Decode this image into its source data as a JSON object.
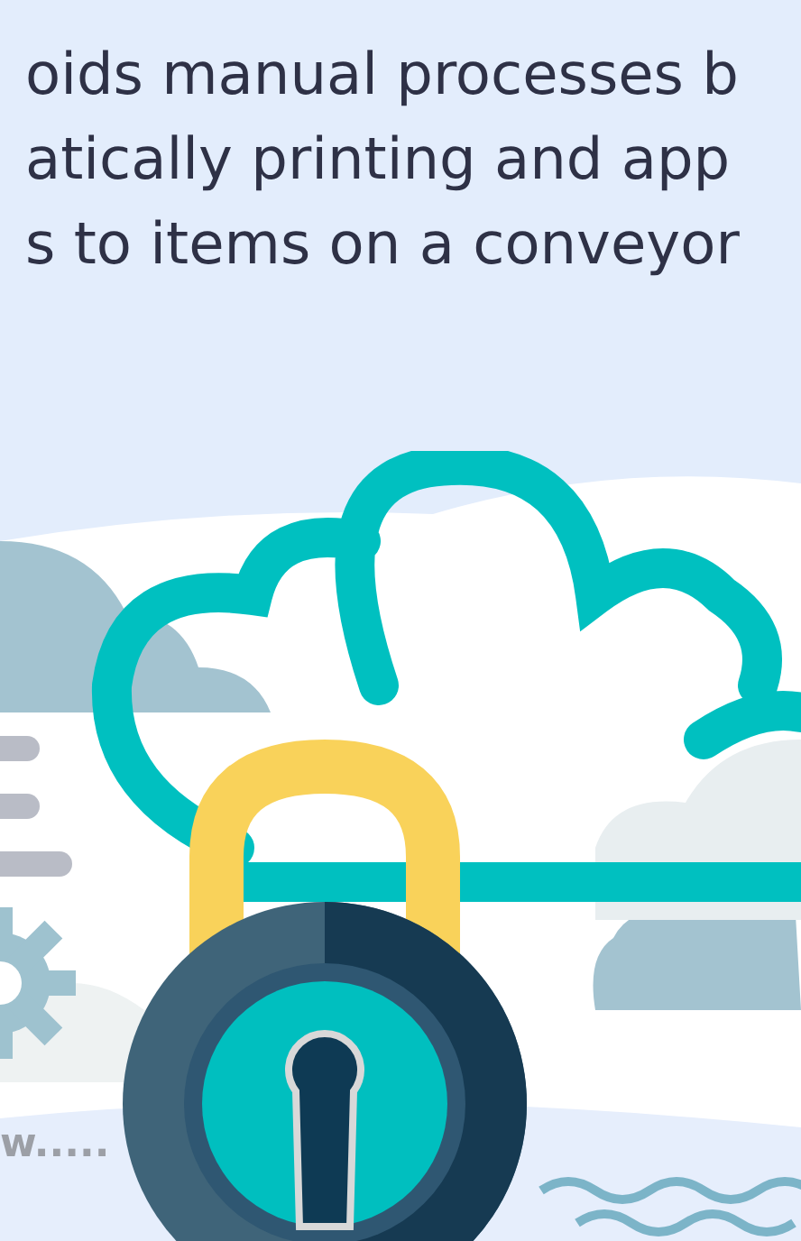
{
  "heading_lines": [
    "oids manual processes b",
    "atically printing and app",
    "s to items on a conveyor"
  ],
  "illustration_caption": "w....."
}
